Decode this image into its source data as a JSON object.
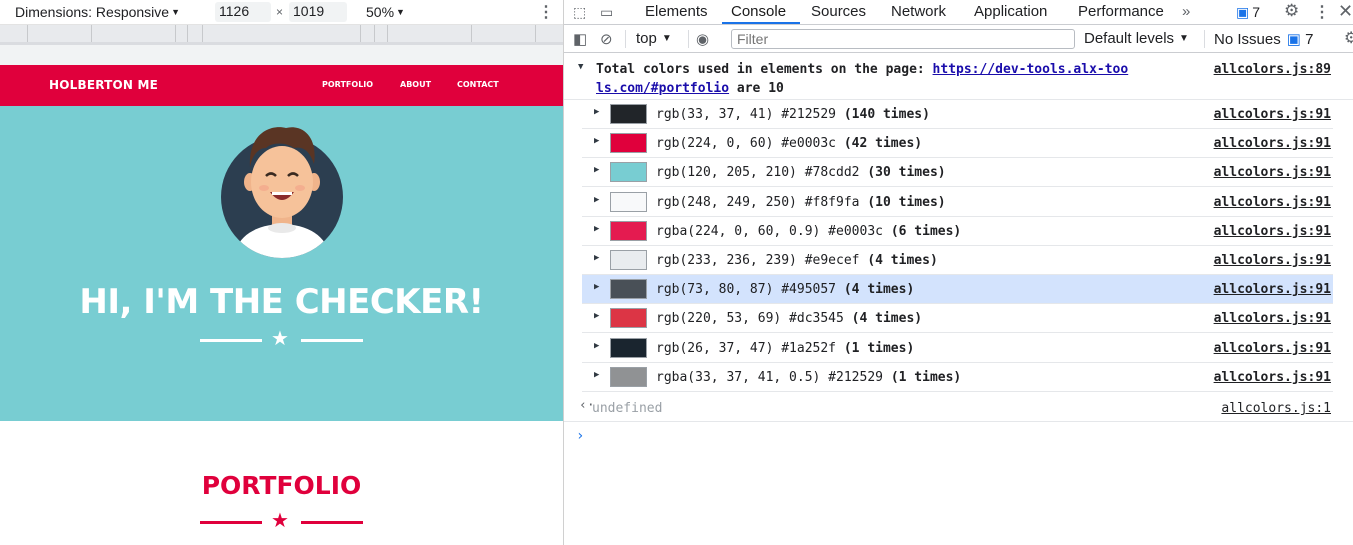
{
  "device_toolbar": {
    "dimensions_label": "Dimensions: Responsive",
    "width_value": "1126",
    "times": "×",
    "height_value": "1019",
    "zoom_label": "50%"
  },
  "site": {
    "brand": "HOLBERTON ME",
    "nav": [
      "PORTFOLIO",
      "ABOUT",
      "CONTACT"
    ],
    "hero_title": "HI, I'M THE CHECKER!",
    "portfolio_title": "PORTFOLIO",
    "colors": {
      "primary": "#e0003c",
      "hero": "#78cdd2",
      "dark": "#2c3e50"
    }
  },
  "devtools": {
    "tabs": [
      "Elements",
      "Console",
      "Sources",
      "Network",
      "Application",
      "Performance"
    ],
    "active_tab": "Console",
    "more_tabs": "»",
    "issues_badge_count": "7",
    "context": "top",
    "filter_placeholder": "Filter",
    "levels": "Default levels",
    "no_issues": "No Issues",
    "issues_count": "7"
  },
  "console": {
    "header_prefix": "Total colors used in elements on the page: ",
    "header_link_1": "https://dev-tools.alx-too",
    "header_link_2": "ls.com/#portfolio",
    "header_suffix": " are 10",
    "header_source": "allcolors.js:89",
    "rows": [
      {
        "swatch": "#212529",
        "text": "rgb(33, 37, 41) #212529 ",
        "count": "(140 times)",
        "source": "allcolors.js:91"
      },
      {
        "swatch": "#e0003c",
        "text": "rgb(224, 0, 60) #e0003c ",
        "count": "(42 times)",
        "source": "allcolors.js:91"
      },
      {
        "swatch": "#78cdd2",
        "text": "rgb(120, 205, 210) #78cdd2 ",
        "count": "(30 times)",
        "source": "allcolors.js:91"
      },
      {
        "swatch": "#f8f9fa",
        "text": "rgb(248, 249, 250) #f8f9fa ",
        "count": "(10 times)",
        "source": "allcolors.js:91"
      },
      {
        "swatch": "#e41b50",
        "text": "rgba(224, 0, 60, 0.9) #e0003c ",
        "count": "(6 times)",
        "source": "allcolors.js:91"
      },
      {
        "swatch": "#e9ecef",
        "text": "rgb(233, 236, 239) #e9ecef ",
        "count": "(4 times)",
        "source": "allcolors.js:91"
      },
      {
        "swatch": "#495057",
        "text": "rgb(73, 80, 87) #495057 ",
        "count": "(4 times)",
        "source": "allcolors.js:91"
      },
      {
        "swatch": "#dc3545",
        "text": "rgb(220, 53, 69) #dc3545 ",
        "count": "(4 times)",
        "source": "allcolors.js:91"
      },
      {
        "swatch": "#1a252f",
        "text": "rgb(26, 37, 47) #1a252f ",
        "count": "(1 times)",
        "source": "allcolors.js:91"
      },
      {
        "swatch": "#909294",
        "text": "rgba(33, 37, 41, 0.5) #212529 ",
        "count": "(1 times)",
        "source": "allcolors.js:91"
      }
    ],
    "highlighted_row": 6,
    "result": "undefined",
    "result_source": "allcolors.js:1"
  }
}
